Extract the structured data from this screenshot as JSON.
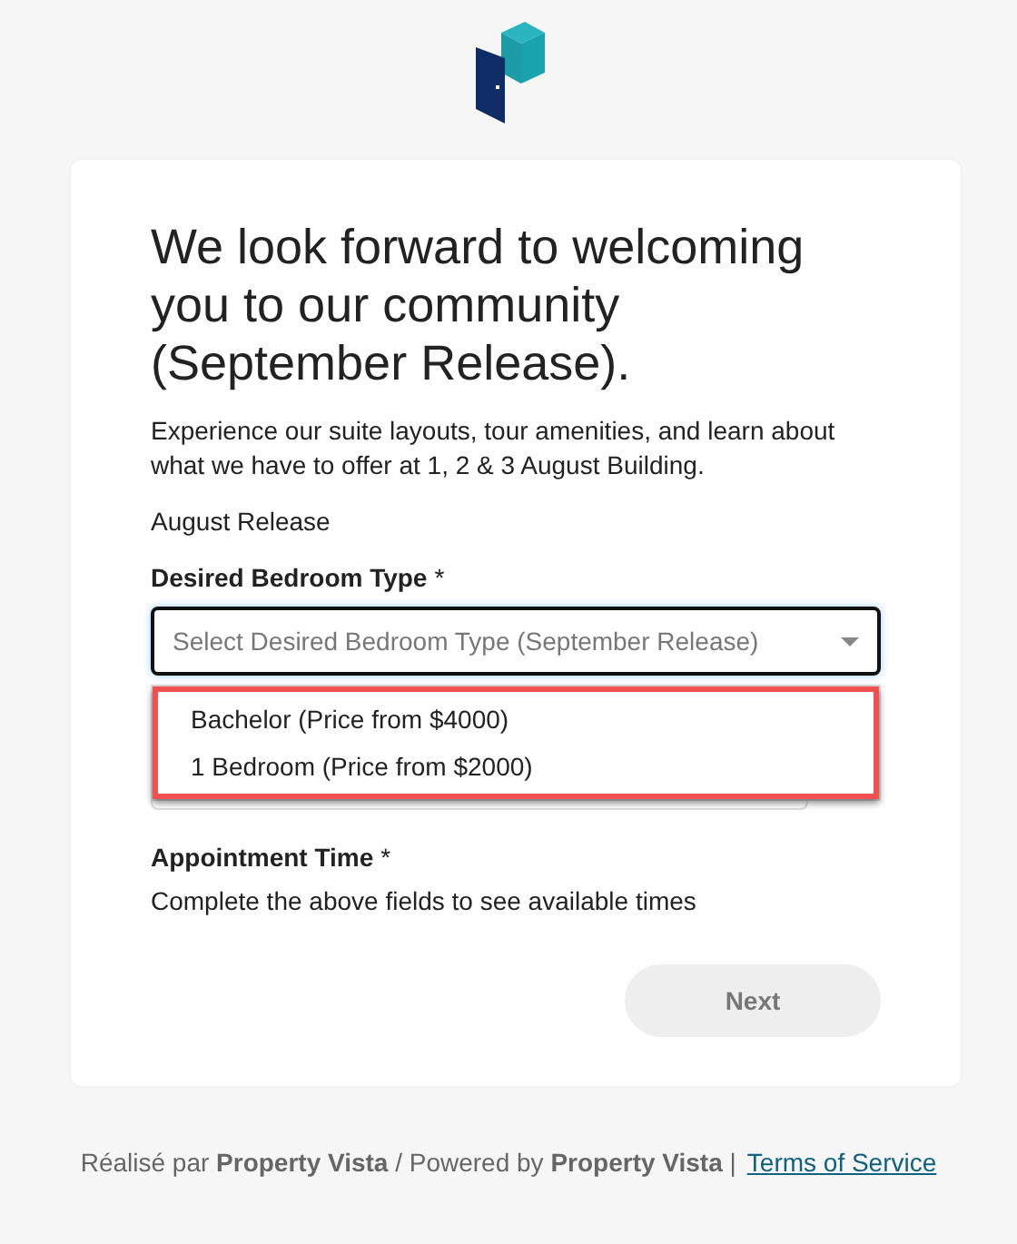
{
  "heading": "We look forward to welcoming you to our community (September Release).",
  "intro": "Experience our suite layouts, tour amenities, and learn about what we have to offer at 1, 2 & 3 August Building.",
  "release": "August Release",
  "bedroom_field": {
    "label": "Desired Bedroom Type",
    "required_mark": "*",
    "placeholder": "Select Desired Bedroom Type (September Release)",
    "expanded": true,
    "options": [
      {
        "label": "Bachelor (Price from $4000)",
        "selected": false
      },
      {
        "label": "1 Bedroom (Price from $2000)",
        "selected": false
      }
    ]
  },
  "appointment": {
    "label": "Appointment Time",
    "required_mark": "*",
    "hint": "Complete the above fields to see available times"
  },
  "next_button": {
    "label": "Next",
    "disabled": true
  },
  "footer": {
    "credit": "Réalisé par **Property Vista** / Powered by **Property Vista** |",
    "link": "Terms of Service"
  }
}
